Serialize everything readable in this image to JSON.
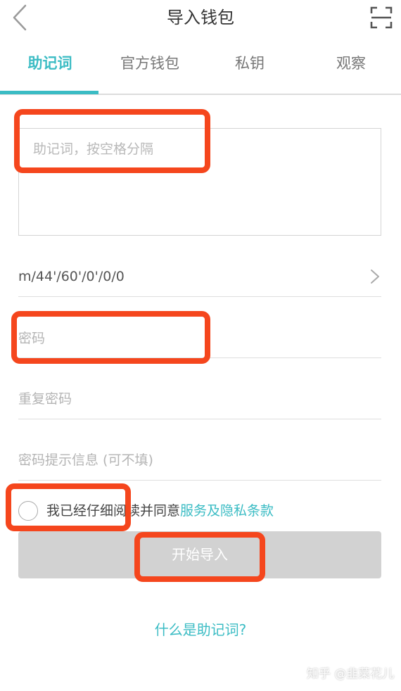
{
  "header": {
    "title": "导入钱包",
    "back_icon": "chevron-left-icon",
    "scan_icon": "scan-icon"
  },
  "tabs": [
    {
      "label": "助记词",
      "active": true
    },
    {
      "label": "官方钱包",
      "active": false
    },
    {
      "label": "私钥",
      "active": false
    },
    {
      "label": "观察",
      "active": false
    }
  ],
  "form": {
    "mnemonic_placeholder": "助记词，按空格分隔",
    "mnemonic_value": "",
    "derivation_path": "m/44'/60'/0'/0/0",
    "password_placeholder": "密码",
    "repeat_password_placeholder": "重复密码",
    "password_hint_placeholder": "密码提示信息 (可不填)",
    "agree_text": "我已经仔细阅读并同意",
    "agree_link": "服务及隐私条款",
    "agree_checked": false,
    "import_button": "开始导入",
    "help_link": "什么是助记词?"
  },
  "watermark": "知乎 @韭菜花儿",
  "colors": {
    "accent": "#3bbcc4",
    "button_disabled": "#d2d2d2",
    "highlight": "#f5461d"
  }
}
